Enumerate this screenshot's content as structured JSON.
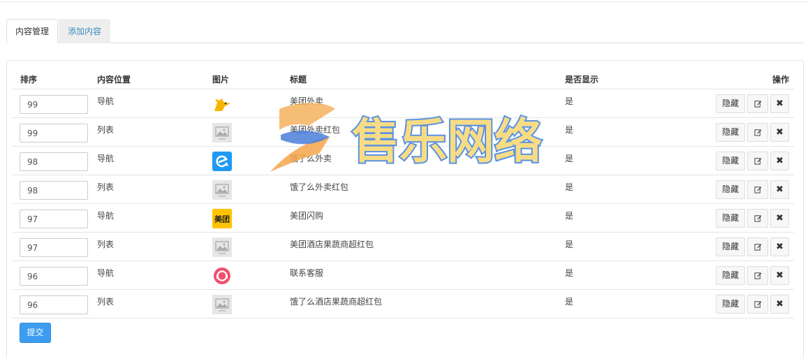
{
  "tabs": [
    {
      "label": "内容管理",
      "active": true
    },
    {
      "label": "添加内容",
      "active": false
    }
  ],
  "table": {
    "headers": {
      "sort": "排序",
      "position": "内容位置",
      "image": "图片",
      "title": "标题",
      "show": "是否显示",
      "ops": "操作"
    },
    "rows": [
      {
        "sort": "99",
        "position": "导航",
        "image": "mascot-icon",
        "title": "美团外卖",
        "show": "是",
        "hide": "隐藏"
      },
      {
        "sort": "99",
        "position": "列表",
        "image": "placeholder-image",
        "title": "美团外卖红包",
        "show": "是",
        "hide": "隐藏"
      },
      {
        "sort": "98",
        "position": "导航",
        "image": "ele-logo-icon",
        "title": "饿了么外卖",
        "show": "是",
        "hide": "隐藏"
      },
      {
        "sort": "98",
        "position": "列表",
        "image": "placeholder-image",
        "title": "饿了么外卖红包",
        "show": "是",
        "hide": "隐藏"
      },
      {
        "sort": "97",
        "position": "导航",
        "image": "meituan-logo-icon",
        "title": "美团闪购",
        "show": "是",
        "hide": "隐藏"
      },
      {
        "sort": "97",
        "position": "列表",
        "image": "placeholder-image",
        "title": "美团酒店果蔬商超红包",
        "show": "是",
        "hide": "隐藏"
      },
      {
        "sort": "96",
        "position": "导航",
        "image": "support-logo-icon",
        "title": "联系客服",
        "show": "是",
        "hide": "隐藏"
      },
      {
        "sort": "96",
        "position": "列表",
        "image": "placeholder-image",
        "title": "饿了么酒店果蔬商超红包",
        "show": "是",
        "hide": "隐藏"
      }
    ]
  },
  "logo_texts": {
    "meituan": "美团",
    "watermark": "售乐网络"
  },
  "submit_label": "提交",
  "colors": {
    "accent": "#3c9cf0",
    "tab_link": "#3c8dbc",
    "meituan_yellow": "#ffc300",
    "ele_blue": "#1e9af5",
    "support_red": "#f0506e"
  }
}
